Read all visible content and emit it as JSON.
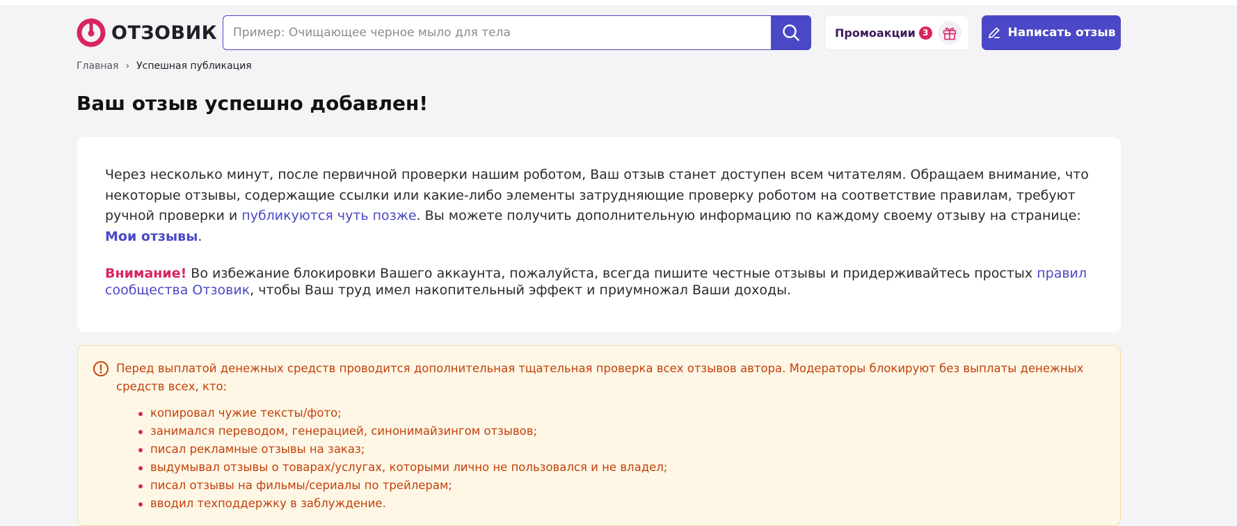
{
  "header": {
    "logo_text": "ОТЗОВИК",
    "search_placeholder": "Пример: Очищающее черное мыло для тела",
    "promo_label": "Промоакции",
    "promo_count": "3",
    "write_review_label": "Написать отзыв"
  },
  "breadcrumb": {
    "home": "Главная",
    "separator": "›",
    "current": "Успешная публикация"
  },
  "page_title": "Ваш отзыв успешно добавлен!",
  "info": {
    "p1_text1": "Через несколько минут, после первичной проверки нашим роботом, Ваш отзыв станет доступен всем читателям. Обращаем внимание, что некоторые отзывы, содержащие ссылки или какие-либо элементы затрудняющие проверку роботом на соответствие правилам, требуют ручной проверки и ",
    "p1_link": "публикуются чуть позже",
    "p1_text2": ". Вы можете получить дополнительную информацию по каждому своему отзыву на странице: ",
    "p1_link2": "Мои отзывы",
    "p1_end": ".",
    "warning_label": "Внимание!",
    "p2_text1": " Во избежание блокировки Вашего аккаунта, пожалуйста, всегда пишите честные отзывы и придерживайтесь простых ",
    "p2_link": "правил сообщества Отзовик",
    "p2_text2": ", чтобы Ваш труд имел накопительный эффект и приумножал Ваши доходы."
  },
  "alert": {
    "intro": "Перед выплатой денежных средств проводится дополнительная тщательная проверка всех отзывов автора. Модераторы блокируют без выплаты денежных средств всех, кто:",
    "items": [
      "копировал чужие тексты/фото;",
      "занимался переводом, генерацией, синонимайзингом отзывов;",
      "писал рекламные отзывы на заказ;",
      "выдумывал отзывы о товарах/услугах, которыми лично не пользовался и не владел;",
      "писал отзывы на фильмы/сериалы по трейлерам;",
      "вводил техподдержку в заблуждение."
    ]
  },
  "colors": {
    "brand_primary": "#4a48c6",
    "brand_accent": "#d8245f",
    "alert_background": "#fff7e6",
    "alert_text": "#c2410c"
  },
  "icons": [
    "logo-mark-icon",
    "search-icon",
    "gift-icon",
    "pencil-icon",
    "alert-circle-icon"
  ]
}
